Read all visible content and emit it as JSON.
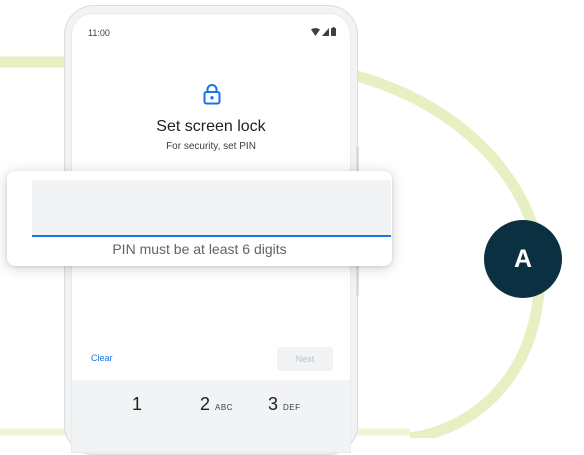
{
  "status_bar": {
    "time": "11:00"
  },
  "screen": {
    "title": "Set screen lock",
    "subtitle": "For security, set PIN",
    "clear_label": "Clear",
    "next_label": "Next"
  },
  "pin_card": {
    "helper_text": "PIN must be at least 6 digits"
  },
  "keypad": {
    "keys": [
      {
        "digit": "1",
        "letters": ""
      },
      {
        "digit": "2",
        "letters": "ABC"
      },
      {
        "digit": "3",
        "letters": "DEF"
      }
    ]
  },
  "avatar": {
    "letter": "A"
  },
  "colors": {
    "accent": "#1a73e8",
    "decor_arc": "#e6f0c2",
    "avatar_bg": "#0b3041"
  }
}
